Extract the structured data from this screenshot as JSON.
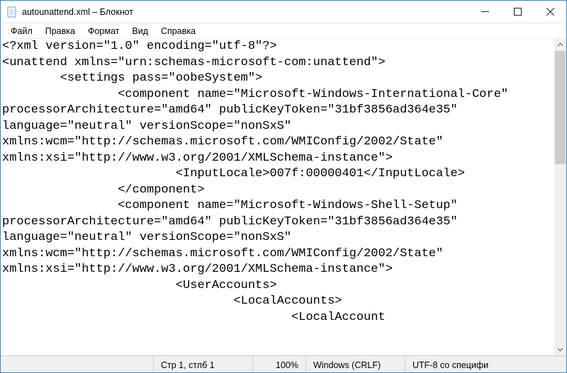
{
  "titlebar": {
    "title": "autounattend.xml – Блокнот"
  },
  "menubar": {
    "items": [
      "Файл",
      "Правка",
      "Формат",
      "Вид",
      "Справка"
    ]
  },
  "editor": {
    "content": "<?xml version=\"1.0\" encoding=\"utf-8\"?>\n<unattend xmlns=\"urn:schemas-microsoft-com:unattend\">\n        <settings pass=\"oobeSystem\">\n                <component name=\"Microsoft-Windows-International-Core\"\nprocessorArchitecture=\"amd64\" publicKeyToken=\"31bf3856ad364e35\"\nlanguage=\"neutral\" versionScope=\"nonSxS\"\nxmlns:wcm=\"http://schemas.microsoft.com/WMIConfig/2002/State\"\nxmlns:xsi=\"http://www.w3.org/2001/XMLSchema-instance\">\n                        <InputLocale>007f:00000401</InputLocale>\n                </component>\n                <component name=\"Microsoft-Windows-Shell-Setup\"\nprocessorArchitecture=\"amd64\" publicKeyToken=\"31bf3856ad364e35\"\nlanguage=\"neutral\" versionScope=\"nonSxS\"\nxmlns:wcm=\"http://schemas.microsoft.com/WMIConfig/2002/State\"\nxmlns:xsi=\"http://www.w3.org/2001/XMLSchema-instance\">\n                        <UserAccounts>\n                                <LocalAccounts>\n                                        <LocalAccount"
  },
  "statusbar": {
    "position": "Стр 1, стлб 1",
    "zoom": "100%",
    "eol": "Windows (CRLF)",
    "encoding": "UTF-8 со специфи"
  }
}
